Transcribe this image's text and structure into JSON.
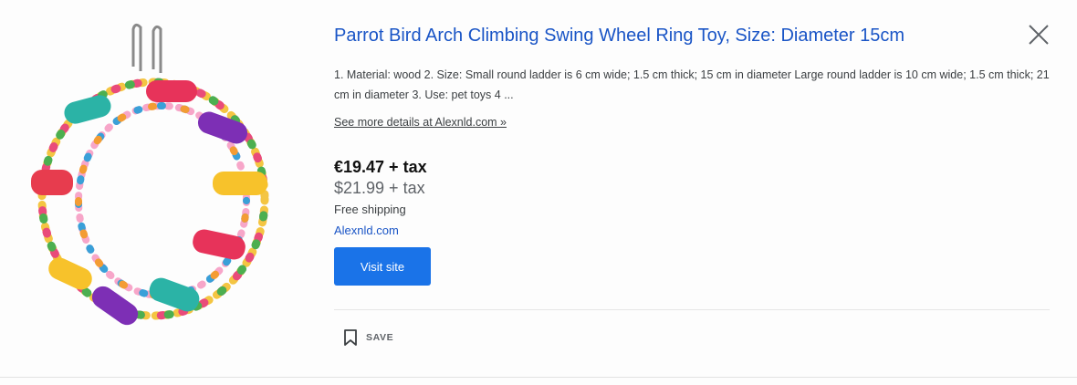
{
  "product": {
    "title": "Parrot Bird Arch Climbing Swing Wheel Ring Toy, Size: Diameter 15cm",
    "description": "1. Material: wood 2. Size: Small round ladder is 6 cm wide; 1.5 cm thick; 15 cm in diameter Large round ladder is 10 cm wide; 1.5 cm thick; 21 cm in diameter 3. Use: pet toys 4 ...",
    "details_link": "See more details at Alexnld.com »",
    "price_main": "€19.47 + tax",
    "price_alt": "$21.99 + tax",
    "shipping": "Free shipping",
    "seller": "Alexnld.com",
    "visit_label": "Visit site",
    "save_label": "SAVE"
  },
  "icons": {
    "close": "close-icon",
    "save": "bookmark-icon"
  },
  "colors": {
    "link": "#1a55c6",
    "button": "#1a73e8"
  }
}
